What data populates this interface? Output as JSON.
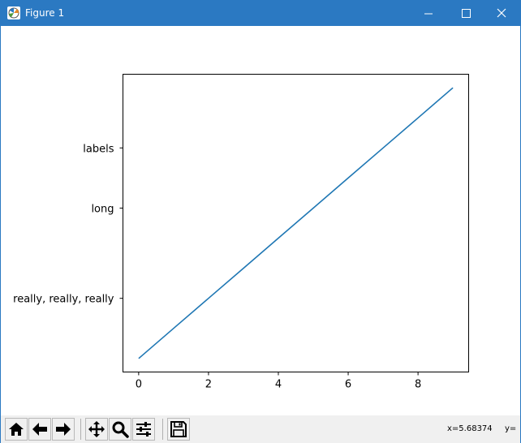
{
  "window": {
    "title": "Figure 1",
    "app_icon": "matplotlib-figure-icon",
    "controls": {
      "minimize": "minimize-icon",
      "maximize": "maximize-icon",
      "close": "close-icon"
    }
  },
  "chart_data": {
    "type": "line",
    "title": "",
    "xlabel": "",
    "ylabel": "",
    "x": [
      0,
      1,
      2,
      3,
      4,
      5,
      6,
      7,
      8,
      9
    ],
    "series": [
      {
        "values": [
          0,
          1,
          2,
          3,
          4,
          5,
          6,
          7,
          8,
          9
        ],
        "color": "#1f77b4"
      }
    ],
    "xticks": [
      0,
      2,
      4,
      6,
      8
    ],
    "xtick_labels": [
      "0",
      "2",
      "4",
      "6",
      "8"
    ],
    "yticks": [
      2,
      5,
      7
    ],
    "ytick_labels": [
      "really, really, really",
      "long",
      "labels"
    ],
    "xlim": [
      -0.45,
      9.45
    ],
    "ylim": [
      -0.45,
      9.45
    ],
    "grid": false,
    "legend": "none"
  },
  "toolbar": {
    "buttons": [
      {
        "name": "home-button",
        "icon": "home-icon"
      },
      {
        "name": "back-button",
        "icon": "arrow-left-icon"
      },
      {
        "name": "forward-button",
        "icon": "arrow-right-icon"
      },
      {
        "name": "pan-button",
        "icon": "move-icon"
      },
      {
        "name": "zoom-button",
        "icon": "magnifier-icon"
      },
      {
        "name": "configure-subplots-button",
        "icon": "sliders-icon"
      },
      {
        "name": "save-button",
        "icon": "floppy-disk-icon"
      }
    ],
    "coords": {
      "x_text": "x=5.68374",
      "y_text": "y="
    }
  }
}
